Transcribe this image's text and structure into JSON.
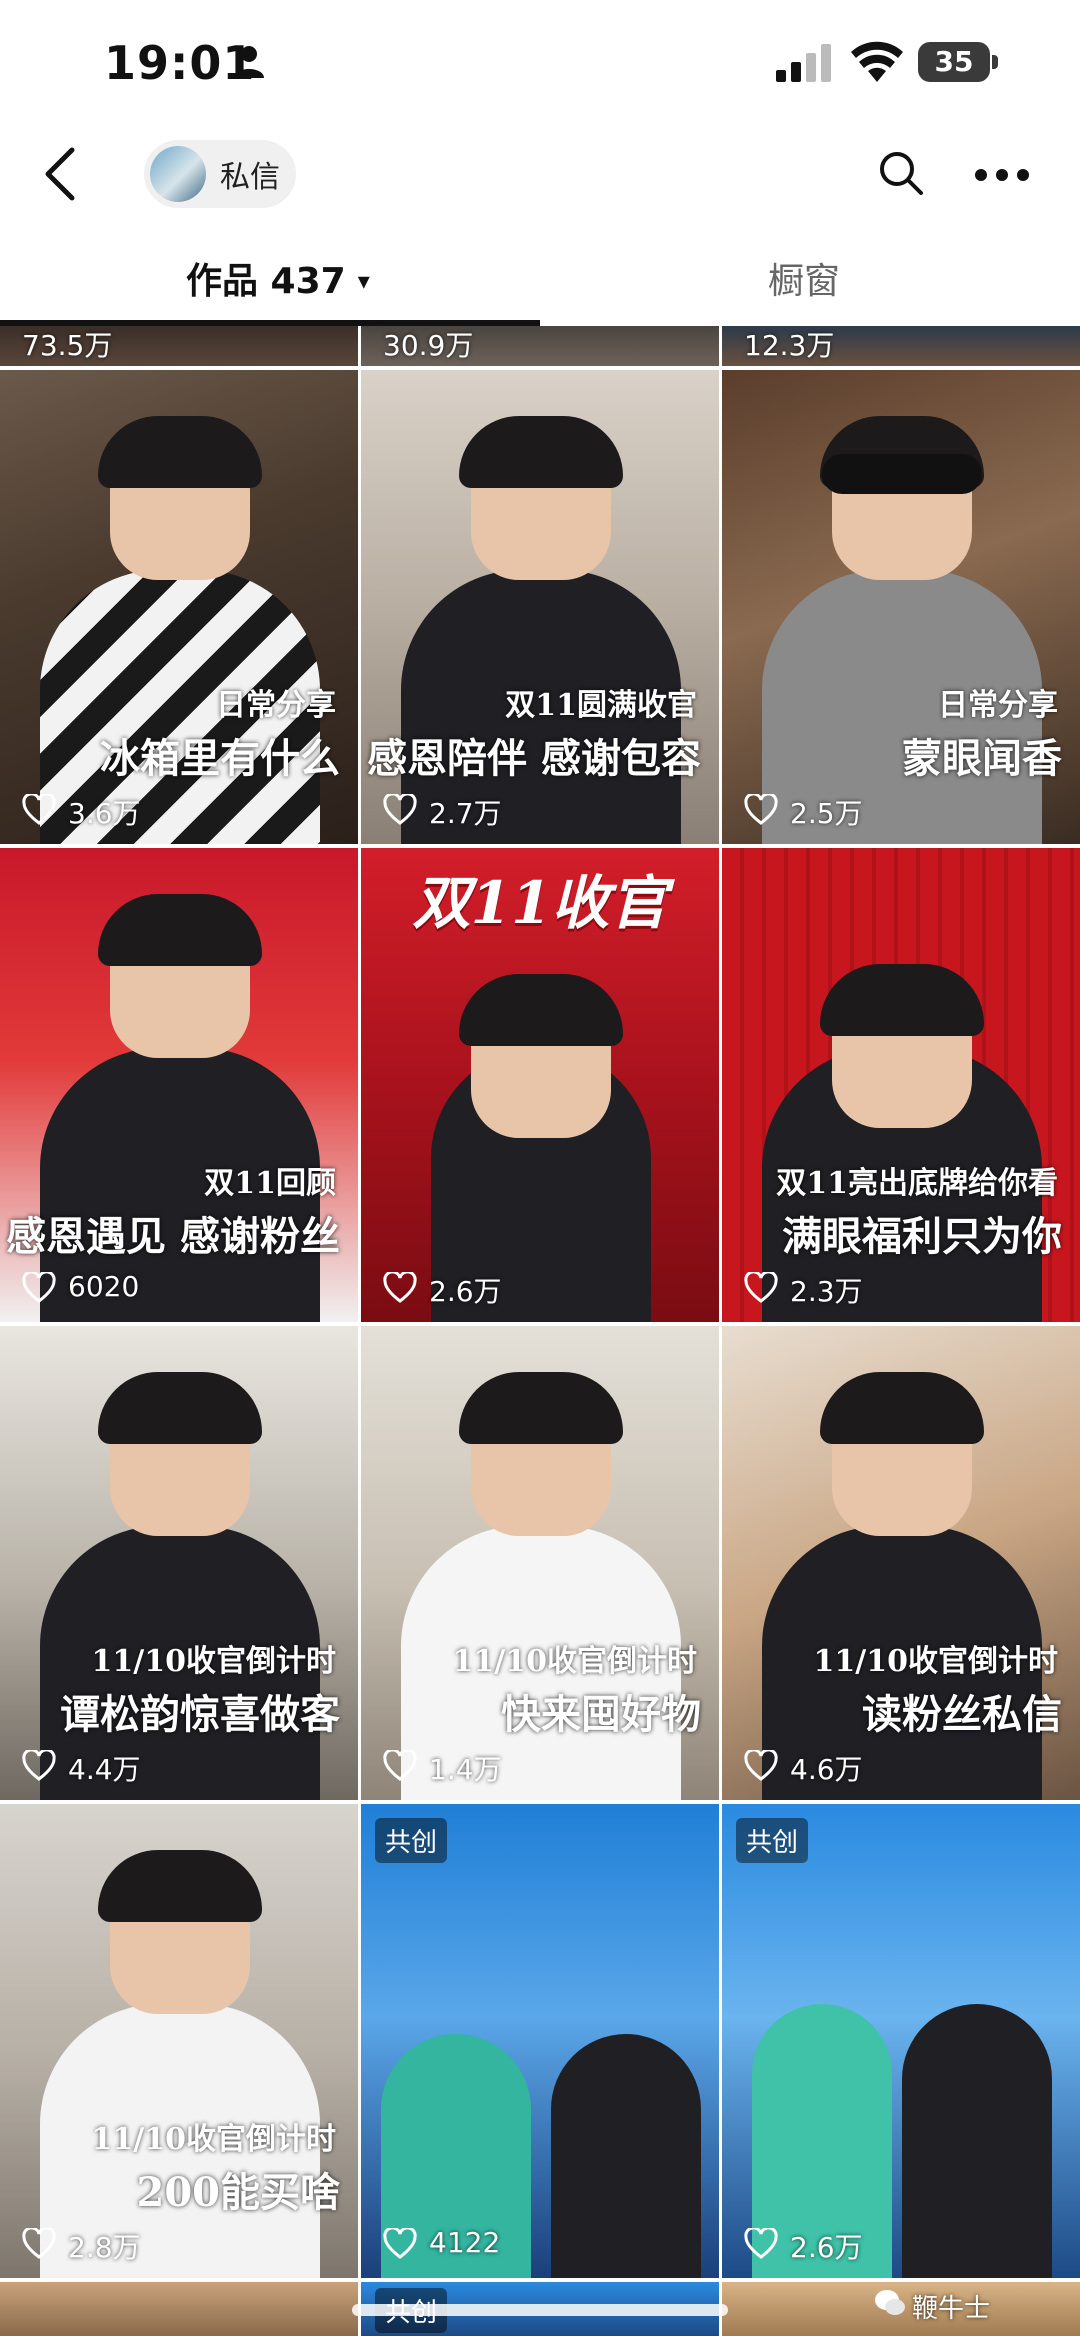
{
  "status_bar": {
    "time": "19:01",
    "battery": "35"
  },
  "header": {
    "dm_label": "私信"
  },
  "tabs": [
    {
      "label": "作品 437",
      "caret": "▾"
    },
    {
      "label": "橱窗"
    }
  ],
  "top_row_likes": [
    "73.5万",
    "30.9万",
    "12.3万"
  ],
  "videos": [
    {
      "caption_top": "日常分享",
      "caption_main": "冰箱里有什么",
      "likes": "3.6万",
      "collab": ""
    },
    {
      "caption_top": "双11圆满收官",
      "caption_main": "感恩陪伴 感谢包容",
      "likes": "2.7万",
      "collab": ""
    },
    {
      "caption_top": "日常分享",
      "caption_main": "蒙眼闻香",
      "likes": "2.5万",
      "collab": ""
    },
    {
      "caption_top": "双11回顾",
      "caption_main": "感恩遇见 感谢粉丝",
      "likes": "6020",
      "collab": ""
    },
    {
      "caption_top": "",
      "caption_main": "",
      "likes": "2.6万",
      "collab": "",
      "banner": "双11收官"
    },
    {
      "caption_top": "双11亮出底牌给你看",
      "caption_main": "满眼福利只为你",
      "likes": "2.3万",
      "collab": ""
    },
    {
      "caption_top": "11/10收官倒计时",
      "caption_main": "谭松韵惊喜做客",
      "likes": "4.4万",
      "collab": ""
    },
    {
      "caption_top": "11/10收官倒计时",
      "caption_main": "快来囤好物",
      "likes": "1.4万",
      "collab": ""
    },
    {
      "caption_top": "11/10收官倒计时",
      "caption_main": "读粉丝私信",
      "likes": "4.6万",
      "collab": ""
    },
    {
      "caption_top": "11/10收官倒计时",
      "caption_main": "200能买啥",
      "likes": "2.8万",
      "collab": ""
    },
    {
      "caption_top": "",
      "caption_main": "",
      "likes": "4122",
      "collab": "共创"
    },
    {
      "caption_top": "",
      "caption_main": "",
      "likes": "2.6万",
      "collab": "共创"
    }
  ],
  "bottom_row_collab": "共创",
  "watermark": "鞭牛士",
  "colors": {
    "accent_red": "#d8232a",
    "text_dark": "#111111",
    "tab_inactive": "#666666"
  }
}
